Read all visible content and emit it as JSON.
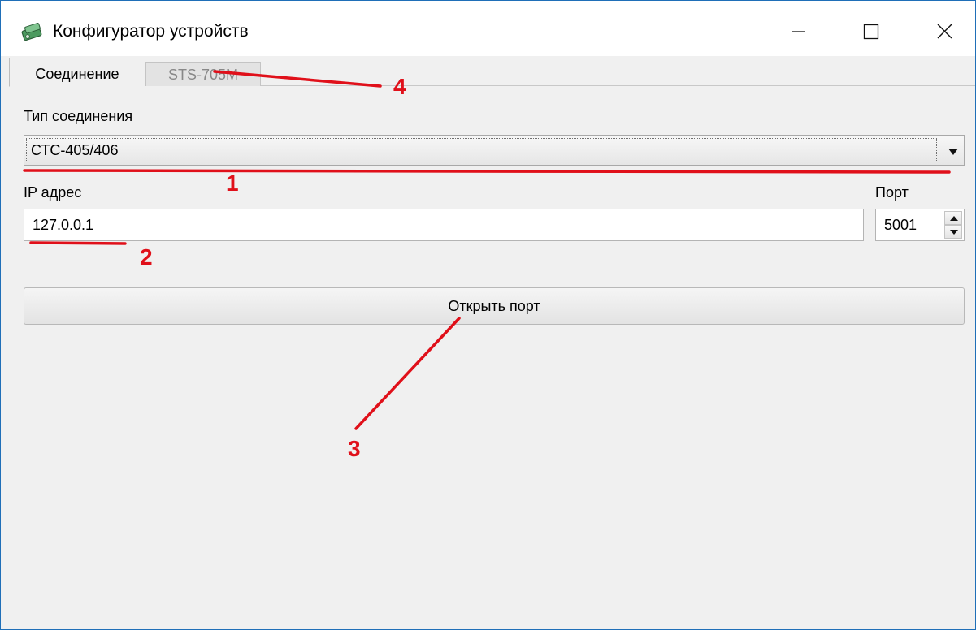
{
  "window": {
    "title": "Конфигуратор устройств",
    "controls": [
      "minimize-icon",
      "maximize-icon",
      "close-icon"
    ]
  },
  "tabs": [
    {
      "label": "Соединение",
      "active": true
    },
    {
      "label": "STS-705M",
      "active": false
    }
  ],
  "connection": {
    "type_label": "Тип соединения",
    "type_value": "СТС-405/406",
    "ip_label": "IP адрес",
    "ip_value": "127.0.0.1",
    "port_label": "Порт",
    "port_value": "5001",
    "open_button": "Открыть порт"
  },
  "annotations": [
    "1",
    "2",
    "3",
    "4"
  ],
  "colors": {
    "annotation": "#e0101a",
    "window_border": "#1f6fb8",
    "panel_bg": "#f0f0f0"
  }
}
